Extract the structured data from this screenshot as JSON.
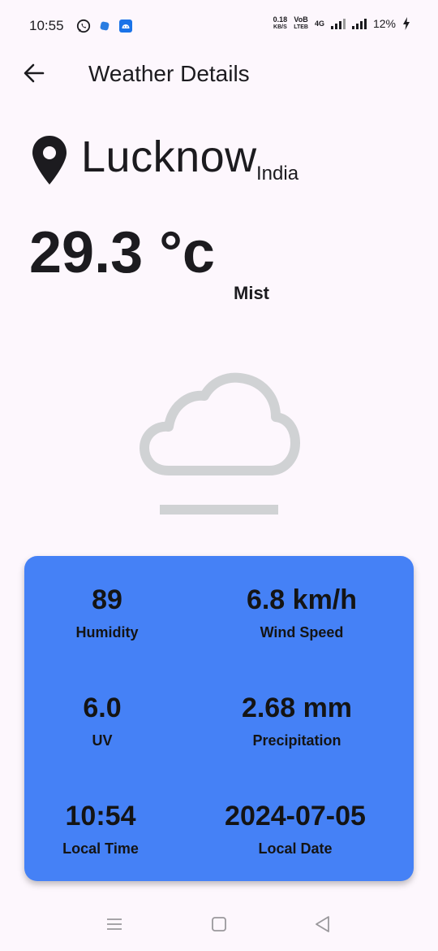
{
  "status_bar": {
    "time": "10:55",
    "speed_value": "0.18",
    "speed_unit": "KB/S",
    "volte_top": "VoB",
    "volte_bottom": "LTEB",
    "network": "4G",
    "battery": "12%"
  },
  "app_bar": {
    "title": "Weather Details",
    "back_icon": "arrow-left-icon"
  },
  "location": {
    "city": "Lucknow",
    "country": "India",
    "icon": "location-pin-icon"
  },
  "current": {
    "temperature": "29.3 °c",
    "condition": "Mist",
    "icon": "mist-cloud-icon"
  },
  "details": {
    "humidity_value": "89",
    "humidity_label": "Humidity",
    "wind_value": "6.8 km/h",
    "wind_label": "Wind Speed",
    "uv_value": "6.0",
    "uv_label": "UV",
    "precip_value": "2.68 mm",
    "precip_label": "Precipitation",
    "local_time_value": "10:54",
    "local_time_label": "Local Time",
    "local_date_value": "2024-07-05",
    "local_date_label": "Local Date"
  },
  "colors": {
    "background": "#fdf7fd",
    "card": "#4581f6",
    "text": "#1c1b1f",
    "icon_grey": "#d0d2d4"
  },
  "nav_bar": {
    "icons": [
      "menu-icon",
      "home-icon",
      "back-triangle-icon"
    ]
  }
}
